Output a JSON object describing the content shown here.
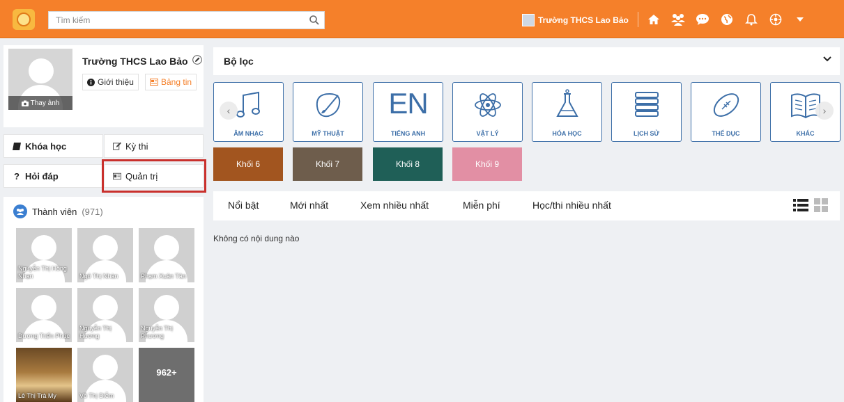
{
  "search": {
    "placeholder": "Tìm kiếm"
  },
  "header": {
    "user_name": "Trường THCS Lao Bảo"
  },
  "colors": {
    "accent": "#f5802a",
    "subject_blue": "#3d6fa8",
    "highlight": "#c9302c"
  },
  "profile": {
    "name": "Trường THCS Lao Bảo",
    "change_photo": "Thay ảnh",
    "about_label": "Giới thiệu",
    "news_label": "Bảng tin"
  },
  "menu": {
    "courses": "Khóa học",
    "exams": "Kỳ thi",
    "qa": "Hỏi đáp",
    "admin": "Quản trị"
  },
  "members": {
    "title": "Thành viên",
    "count": "(971)",
    "list": [
      {
        "name": "Nguyễn Thị Hồng Nhạn"
      },
      {
        "name": "Ngô Thị Nhàn"
      },
      {
        "name": "Phạm Xuân Tân"
      },
      {
        "name": "Dương Triển Phúc"
      },
      {
        "name": "Nguyễn Thị Hương"
      },
      {
        "name": "Nguyễn Thị Phương"
      },
      {
        "name": "Lê Thị Trà My"
      },
      {
        "name": "Võ Thị Diễm"
      }
    ],
    "more": "962+"
  },
  "filter": {
    "label": "Bộ lọc"
  },
  "subjects": [
    {
      "label": "ÂM NHẠC",
      "icon": "music-note-icon"
    },
    {
      "label": "MỸ THUẬT",
      "icon": "paintbrush-icon"
    },
    {
      "label": "TIẾNG ANH",
      "icon": "EN"
    },
    {
      "label": "VẬT LÝ",
      "icon": "atom-icon"
    },
    {
      "label": "HÓA HỌC",
      "icon": "flask-icon"
    },
    {
      "label": "LỊCH SỬ",
      "icon": "books-stack-icon"
    },
    {
      "label": "THỂ DỤC",
      "icon": "football-icon"
    },
    {
      "label": "KHÁC",
      "icon": "open-book-icon"
    }
  ],
  "grades": [
    {
      "label": "Khối 6",
      "color": "#a2551f"
    },
    {
      "label": "Khối 7",
      "color": "#6e5d4c"
    },
    {
      "label": "Khối 8",
      "color": "#1f5f57"
    },
    {
      "label": "Khối 9",
      "color": "#e28fa4"
    }
  ],
  "tabs": [
    {
      "label": "Nổi bật"
    },
    {
      "label": "Mới nhất"
    },
    {
      "label": "Xem nhiều nhất"
    },
    {
      "label": "Miễn phí"
    },
    {
      "label": "Học/thi nhiều nhất"
    }
  ],
  "content": {
    "empty": "Không có nội dung nào"
  }
}
